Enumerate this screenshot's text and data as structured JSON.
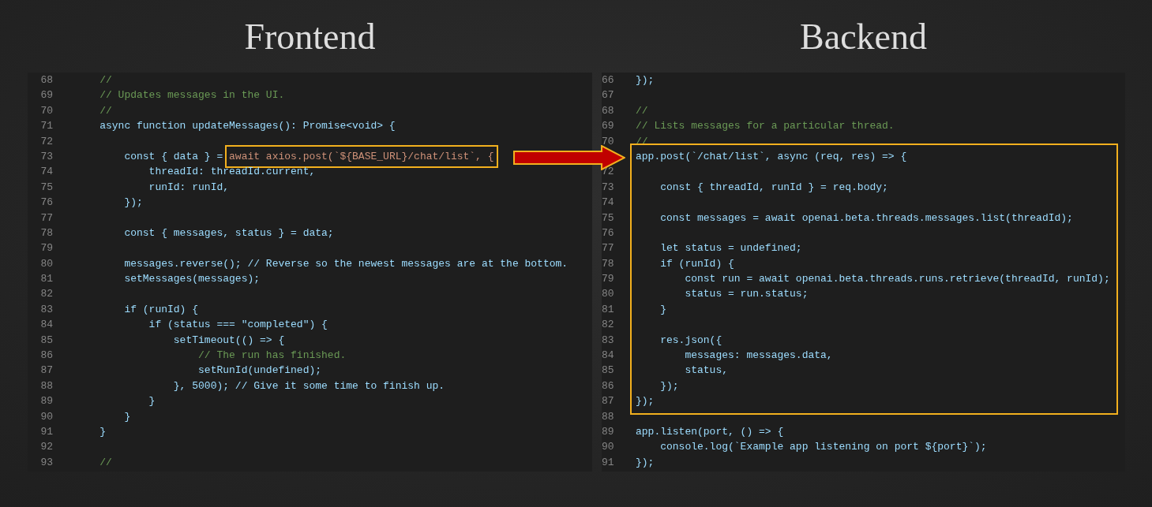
{
  "panels": [
    {
      "title": "Frontend",
      "blocks": [
        {
          "boxed": false,
          "lines": [
            {
              "number": "68",
              "kind": "comment",
              "text": "    //"
            },
            {
              "number": "69",
              "kind": "comment",
              "text": "    // Updates messages in the UI."
            },
            {
              "number": "70",
              "kind": "comment",
              "text": "    //"
            },
            {
              "number": "71",
              "kind": "code",
              "text": "    async function updateMessages(): Promise<void> {"
            },
            {
              "number": "72",
              "kind": "code"
            },
            {
              "number": "73",
              "kind": "code",
              "text": "        const { data } = ",
              "highlight": "await axios.post(`${BASE_URL}/chat/list`, {"
            },
            {
              "number": "74",
              "kind": "code",
              "text": "            threadId: threadId.current,"
            },
            {
              "number": "75",
              "kind": "code",
              "text": "            runId: runId,"
            },
            {
              "number": "76",
              "kind": "code",
              "text": "        });"
            },
            {
              "number": "77",
              "kind": "code"
            },
            {
              "number": "78",
              "kind": "code",
              "text": "        const { messages, status } = data;"
            },
            {
              "number": "79",
              "kind": "code"
            },
            {
              "number": "80",
              "kind": "code",
              "text": "        messages.reverse(); // Reverse so the newest messages are at the bottom."
            },
            {
              "number": "81",
              "kind": "code",
              "text": "        setMessages(messages);"
            },
            {
              "number": "82",
              "kind": "code"
            },
            {
              "number": "83",
              "kind": "code",
              "text": "        if (runId) {"
            },
            {
              "number": "84",
              "kind": "code",
              "text": "            if (status === \"completed\") {"
            },
            {
              "number": "85",
              "kind": "code",
              "text": "                setTimeout(() => {"
            },
            {
              "number": "86",
              "kind": "comment",
              "text": "                    // The run has finished."
            },
            {
              "number": "87",
              "kind": "code",
              "text": "                    setRunId(undefined);"
            },
            {
              "number": "88",
              "kind": "code",
              "text": "                }, 5000); // Give it some time to finish up."
            },
            {
              "number": "89",
              "kind": "code",
              "text": "            }"
            },
            {
              "number": "90",
              "kind": "code",
              "text": "        }"
            },
            {
              "number": "91",
              "kind": "code",
              "text": "    }"
            },
            {
              "number": "92",
              "kind": "code"
            },
            {
              "number": "93",
              "kind": "comment",
              "text": "    //"
            }
          ]
        }
      ]
    },
    {
      "title": "Backend",
      "blocks": [
        {
          "boxed": false,
          "lines": [
            {
              "number": "66",
              "kind": "code",
              "text": "});"
            },
            {
              "number": "67",
              "kind": "code"
            },
            {
              "number": "68",
              "kind": "comment",
              "text": "//"
            },
            {
              "number": "69",
              "kind": "comment",
              "text": "// Lists messages for a particular thread."
            },
            {
              "number": "70",
              "kind": "comment",
              "text": "//"
            }
          ]
        },
        {
          "boxed": true,
          "lines": [
            {
              "kind": "code",
              "text": "app.post(`/chat/list`, async (req, res) => {"
            },
            {
              "number": "72",
              "kind": "code"
            },
            {
              "number": "73",
              "kind": "code",
              "text": "    const { threadId, runId } = req.body;"
            },
            {
              "number": "74",
              "kind": "code"
            },
            {
              "number": "75",
              "kind": "code",
              "text": "    const messages = await openai.beta.threads.messages.list(threadId);"
            },
            {
              "number": "76",
              "kind": "code"
            },
            {
              "number": "77",
              "kind": "code",
              "text": "    let status = undefined;"
            },
            {
              "number": "78",
              "kind": "code",
              "text": "    if (runId) {"
            },
            {
              "number": "79",
              "kind": "code",
              "text": "        const run = await openai.beta.threads.runs.retrieve(threadId, runId);"
            },
            {
              "number": "80",
              "kind": "code",
              "text": "        status = run.status;"
            },
            {
              "number": "81",
              "kind": "code",
              "text": "    }"
            },
            {
              "number": "82",
              "kind": "code"
            },
            {
              "number": "83",
              "kind": "code",
              "text": "    res.json({"
            },
            {
              "number": "84",
              "kind": "code",
              "text": "        messages: messages.data,"
            },
            {
              "number": "85",
              "kind": "code",
              "text": "        status,"
            },
            {
              "number": "86",
              "kind": "code",
              "text": "    });"
            },
            {
              "number": "87",
              "kind": "code",
              "text": "});"
            }
          ]
        },
        {
          "boxed": false,
          "lines": [
            {
              "number": "88",
              "kind": "code"
            },
            {
              "number": "89",
              "kind": "code",
              "text": "app.listen(port, () => {"
            },
            {
              "number": "90",
              "kind": "code",
              "text": "    console.log(`Example app listening on port ${port}`);"
            },
            {
              "number": "91",
              "kind": "code",
              "text": "});"
            }
          ]
        }
      ]
    }
  ]
}
